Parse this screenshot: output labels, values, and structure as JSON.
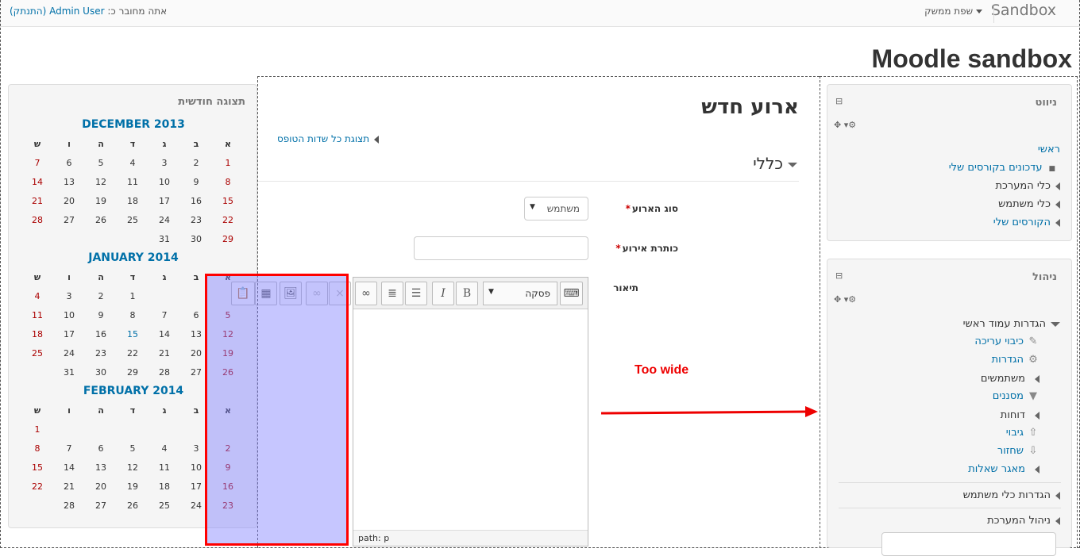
{
  "topbar": {
    "brand": "Sandbox",
    "language": "שפת ממשק",
    "login_prefix": "אתה מחובר כ:",
    "user": "Admin User",
    "logout": "(התנתק)"
  },
  "page": {
    "title": "Moodle sandbox"
  },
  "nav_block": {
    "title": "ניווט",
    "items": [
      "ראשי",
      "עדכונים בקורסים שלי",
      "כלי המערכת",
      "כלי משתמש",
      "הקורסים שלי"
    ]
  },
  "admin_block": {
    "title": "ניהול",
    "items": [
      "הגדרות עמוד ראשי",
      "כיבוי עריכה",
      "הגדרות",
      "משתמשים",
      "מסננים",
      "דוחות",
      "גיבוי",
      "שחזור",
      "מאגר שאלות",
      "הגדרות כלי משתמש",
      "ניהול המערכת"
    ]
  },
  "calendar": {
    "title": "תצוגה חודשית",
    "day_headers": [
      "א",
      "ב",
      "ג",
      "ד",
      "ה",
      "ו",
      "ש"
    ],
    "months": [
      {
        "name": "DECEMBER 2013",
        "weeks": [
          [
            "1",
            "2",
            "3",
            "4",
            "5",
            "6",
            "7"
          ],
          [
            "8",
            "9",
            "10",
            "11",
            "12",
            "13",
            "14"
          ],
          [
            "15",
            "16",
            "17",
            "18",
            "19",
            "20",
            "21"
          ],
          [
            "22",
            "23",
            "24",
            "25",
            "26",
            "27",
            "28"
          ],
          [
            "29",
            "30",
            "31",
            "",
            "",
            "",
            ""
          ]
        ]
      },
      {
        "name": "JANUARY 2014",
        "weeks": [
          [
            "",
            "",
            "",
            "1",
            "2",
            "3",
            "4"
          ],
          [
            "5",
            "6",
            "7",
            "8",
            "9",
            "10",
            "11"
          ],
          [
            "12",
            "13",
            "14",
            "15",
            "16",
            "17",
            "18"
          ],
          [
            "19",
            "20",
            "21",
            "22",
            "23",
            "24",
            "25"
          ],
          [
            "26",
            "27",
            "28",
            "29",
            "30",
            "31",
            ""
          ]
        ]
      },
      {
        "name": "FEBRUARY 2014",
        "weeks": [
          [
            "",
            "",
            "",
            "",
            "",
            "",
            "1"
          ],
          [
            "2",
            "3",
            "4",
            "5",
            "6",
            "7",
            "8"
          ],
          [
            "9",
            "10",
            "11",
            "12",
            "13",
            "14",
            "15"
          ],
          [
            "16",
            "17",
            "18",
            "19",
            "20",
            "21",
            "22"
          ],
          [
            "23",
            "24",
            "25",
            "26",
            "27",
            "28",
            ""
          ]
        ]
      }
    ]
  },
  "form": {
    "title": "ארוע חדש",
    "expand_all": "תצוגת כל שדות הטופס",
    "section": "כללי",
    "event_type_label": "סוג הארוע",
    "event_type_value": "משתמש",
    "event_title_label": "כותרת אירוע",
    "description_label": "תיאור",
    "paragraph_format": "פסקה",
    "editor_path": "path: p"
  },
  "annotation": {
    "text": "Too wide",
    "color": "#ee0000"
  }
}
